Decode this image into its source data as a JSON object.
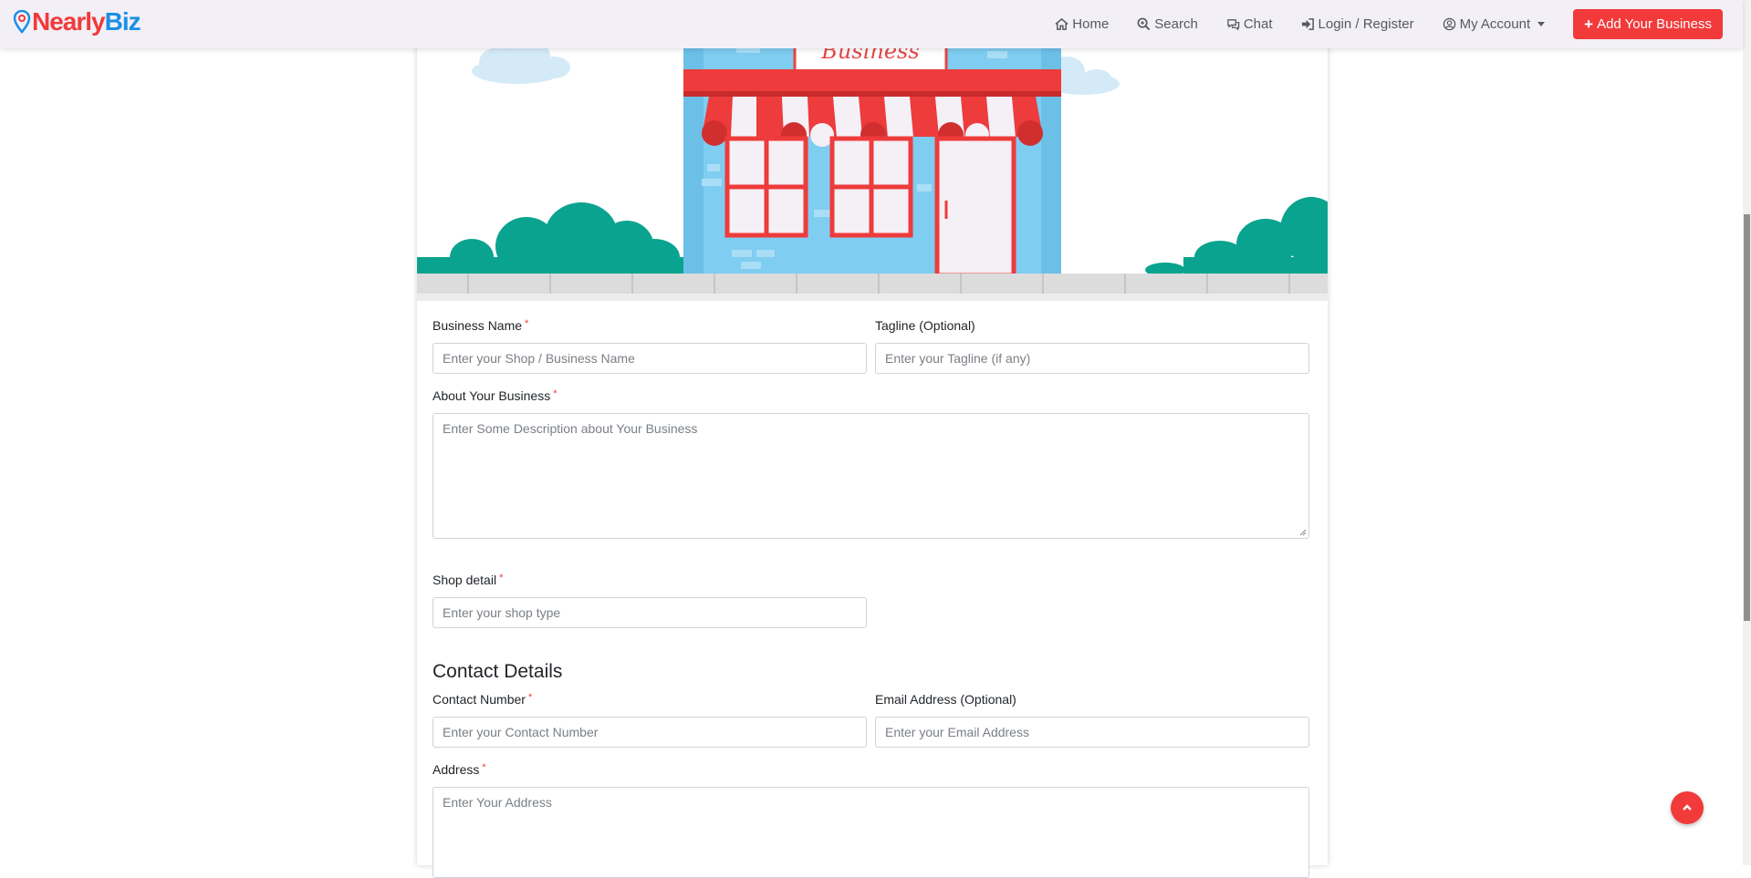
{
  "brand": {
    "part1": "Nearly",
    "part2": "Biz"
  },
  "nav": {
    "home": "Home",
    "search": "Search",
    "chat": "Chat",
    "login": "Login / Register",
    "account": "My Account",
    "add_business": "Add Your Business"
  },
  "banner": {
    "sign_text": "Business"
  },
  "form": {
    "business_name": {
      "label": "Business Name",
      "required": "*",
      "placeholder": "Enter your Shop / Business Name"
    },
    "tagline": {
      "label": "Tagline (Optional)",
      "placeholder": "Enter your Tagline (if any)"
    },
    "about": {
      "label": "About Your Business",
      "required": "*",
      "placeholder": "Enter Some Description about Your Business"
    },
    "shop_detail": {
      "label": "Shop detail",
      "required": "*",
      "placeholder": "Enter your shop type"
    },
    "contact_section": "Contact Details",
    "contact_number": {
      "label": "Contact Number",
      "required": "*",
      "placeholder": "Enter your Contact Number"
    },
    "email": {
      "label": "Email Address (Optional)",
      "placeholder": "Enter your Email Address"
    },
    "address": {
      "label": "Address",
      "required": "*",
      "placeholder": "Enter Your Address"
    }
  },
  "colors": {
    "accent": "#f23a3a",
    "brand_blue": "#1b8fe6",
    "navbar_bg": "#f2f0f6"
  },
  "icons": {
    "home": "home-icon",
    "search": "search-icon",
    "chat": "chat-icon",
    "login": "sign-in-icon",
    "account": "user-circle-icon",
    "add": "plus-icon",
    "top": "chevron-up-icon"
  }
}
